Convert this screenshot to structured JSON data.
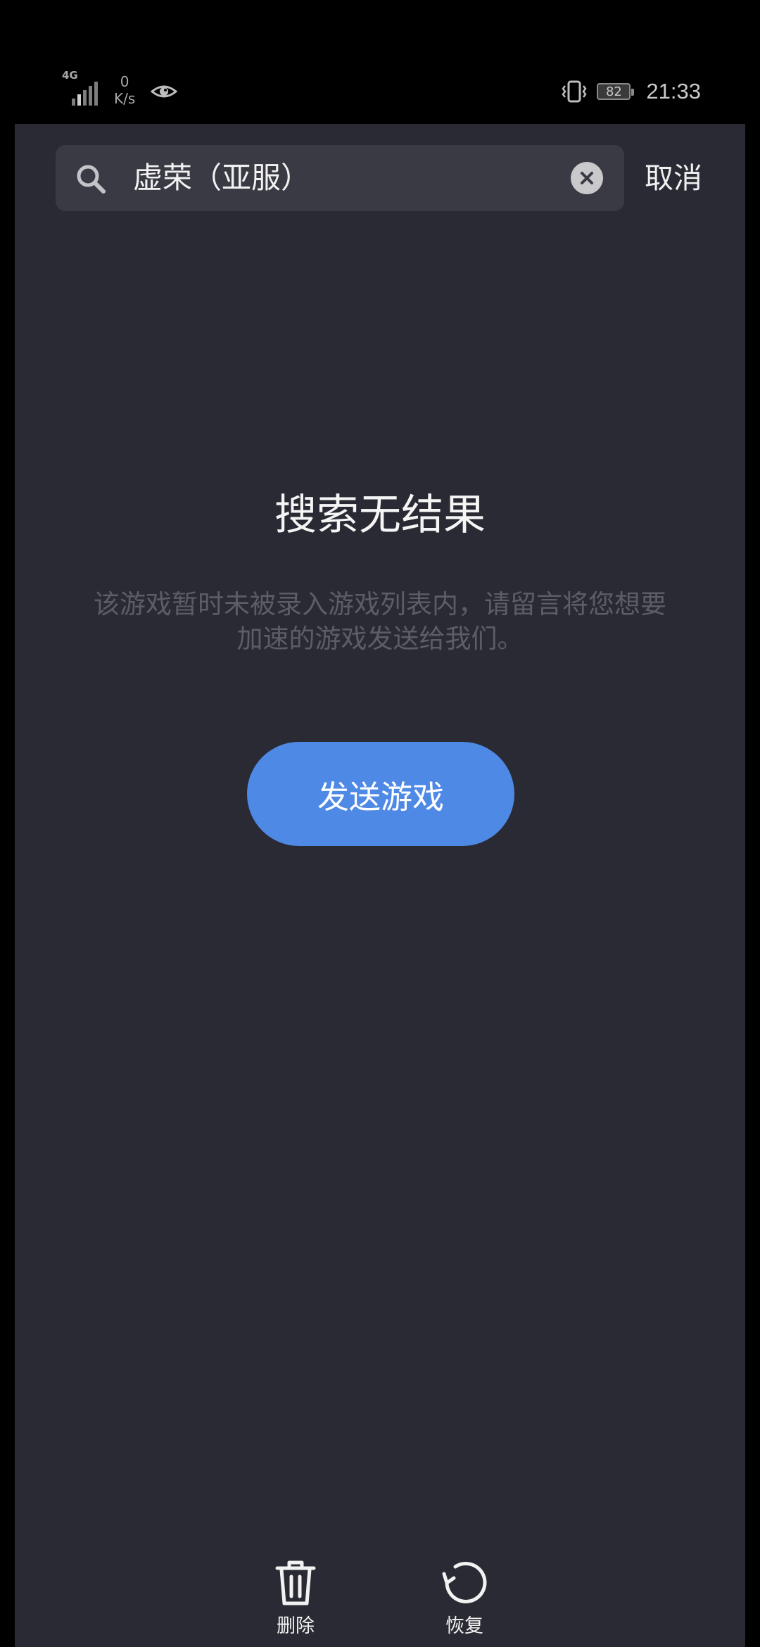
{
  "status_bar": {
    "network_type": "4G",
    "net_speed_value": "0",
    "net_speed_unit": "K/s",
    "battery_level": "82",
    "time": "21:33"
  },
  "search": {
    "query": "虚荣（亚服）",
    "cancel_label": "取消"
  },
  "empty_state": {
    "title": "搜索无结果",
    "description": "该游戏暂时未被录入游戏列表内，请留言将您想要加速的游戏发送给我们。",
    "button_label": "发送游戏"
  },
  "bottom_bar": {
    "delete_label": "删除",
    "restore_label": "恢复"
  },
  "colors": {
    "background": "#292a33",
    "search_box": "#393a44",
    "accent_button": "#4f89e6",
    "description_text": "#5c5d66"
  },
  "icons": {
    "search": "search-icon",
    "clear": "clear-icon",
    "delete": "trash-icon",
    "restore": "restore-icon",
    "eye": "eye-icon",
    "vibrate": "vibrate-icon"
  }
}
